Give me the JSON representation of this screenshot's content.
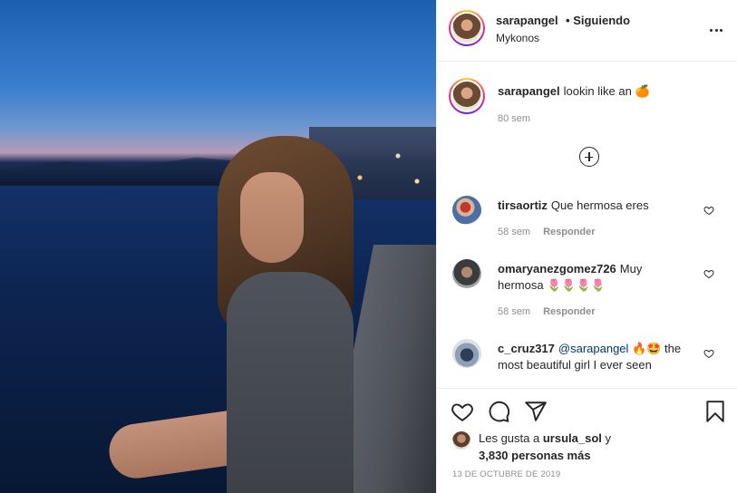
{
  "post": {
    "username": "sarapangel",
    "separator": "•",
    "follow_status": "Siguiendo",
    "location": "Mykonos"
  },
  "caption": {
    "username": "sarapangel",
    "text": "lookin like an",
    "emoji": "🍊",
    "time": "80 sem"
  },
  "comments": [
    {
      "username": "tirsaortiz",
      "text": "Que hermosa eres",
      "time": "58 sem",
      "reply": "Responder"
    },
    {
      "username": "omaryanezgomez726",
      "text": "Muy hermosa",
      "emoji": "🌷🌷🌷🌷",
      "time": "58 sem",
      "reply": "Responder"
    },
    {
      "username": "c_cruz317",
      "mention": "@sarapangel",
      "emoji": "🔥🤩",
      "text": "the most beautiful girl I ever seen"
    }
  ],
  "likes": {
    "prefix": "Les gusta a",
    "user": "ursula_sol",
    "conj": "y",
    "others": "3,830 personas más"
  },
  "date": "13 DE OCTUBRE DE 2019",
  "icons": {
    "more": "more-horizontal-icon",
    "load_more": "plus-circle-icon",
    "like": "heart-icon",
    "comment": "comment-icon",
    "share": "paper-plane-icon",
    "save": "bookmark-icon"
  }
}
